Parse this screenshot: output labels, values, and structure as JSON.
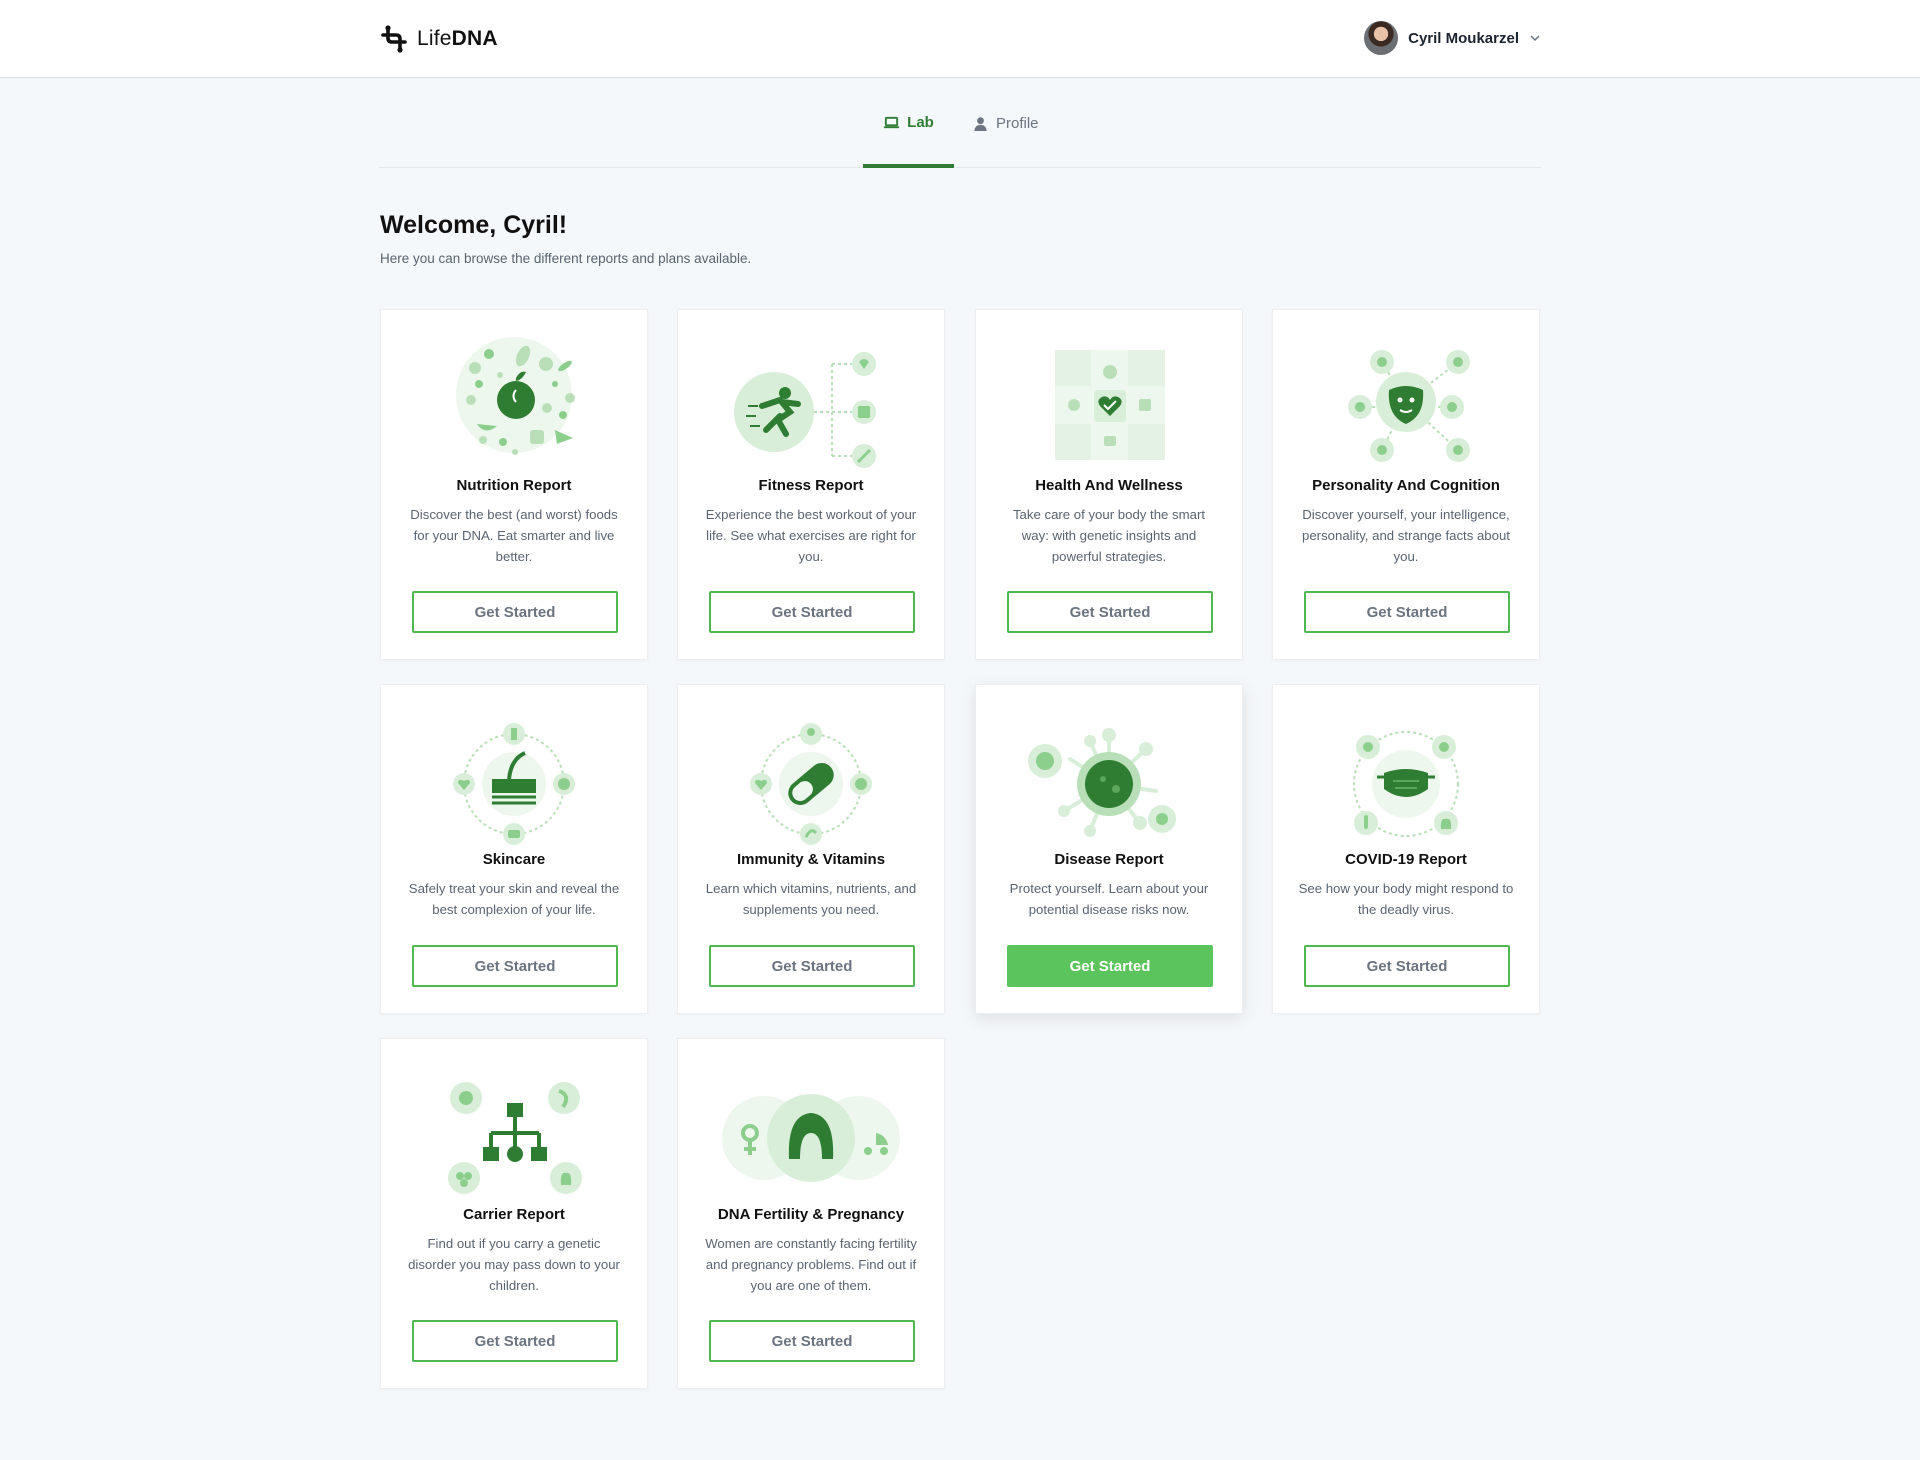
{
  "brand": {
    "name_light": "Life",
    "name_bold": "DNA"
  },
  "user": {
    "name": "Cyril Moukarzel"
  },
  "tabs": [
    {
      "label": "Lab",
      "icon": "laptop-icon",
      "active": true
    },
    {
      "label": "Profile",
      "icon": "person-icon",
      "active": false
    }
  ],
  "welcome": {
    "title": "Welcome, Cyril!",
    "subtitle": "Here you can browse the different reports and plans available."
  },
  "colors": {
    "accent": "#2e7d32",
    "button_border": "#4fb84f",
    "button_filled": "#5cc45c",
    "light_green": "#e3f2e3",
    "mid_green": "#b9dfb9"
  },
  "cards": [
    {
      "title": "Nutrition Report",
      "desc": "Discover the best (and worst) foods for your DNA. Eat smarter and live better.",
      "button": "Get Started",
      "icon": "apple-food-icon"
    },
    {
      "title": "Fitness Report",
      "desc": "Experience the best workout of your life. See what exercises are right for you.",
      "button": "Get Started",
      "icon": "runner-icon"
    },
    {
      "title": "Health And Wellness",
      "desc": "Take care of your body the smart way: with genetic insights and powerful strategies.",
      "button": "Get Started",
      "icon": "puzzle-heart-icon"
    },
    {
      "title": "Personality And Cognition",
      "desc": "Discover yourself, your intelligence, personality, and strange facts about you.",
      "button": "Get Started",
      "icon": "mask-icon"
    },
    {
      "title": "Skincare",
      "desc": "Safely treat your skin and reveal the best complexion of your life.",
      "button": "Get Started",
      "icon": "skin-layer-icon"
    },
    {
      "title": "Immunity & Vitamins",
      "desc": "Learn which vitamins, nutrients, and supplements you need.",
      "button": "Get Started",
      "icon": "pill-icon"
    },
    {
      "title": "Disease Report",
      "desc": "Protect yourself. Learn about your potential disease risks now.",
      "button": "Get Started",
      "icon": "virus-icon"
    },
    {
      "title": "COVID-19 Report",
      "desc": "See how your body might respond to the deadly virus.",
      "button": "Get Started",
      "icon": "face-mask-icon"
    },
    {
      "title": "Carrier Report",
      "desc": "Find out if you carry a genetic disorder you may pass down to your children.",
      "button": "Get Started",
      "icon": "family-tree-icon"
    },
    {
      "title": "DNA Fertility & Pregnancy",
      "desc": "Women are constantly facing fertility and pregnancy problems. Find out if you are one of them.",
      "button": "Get Started",
      "icon": "woman-icon"
    }
  ]
}
